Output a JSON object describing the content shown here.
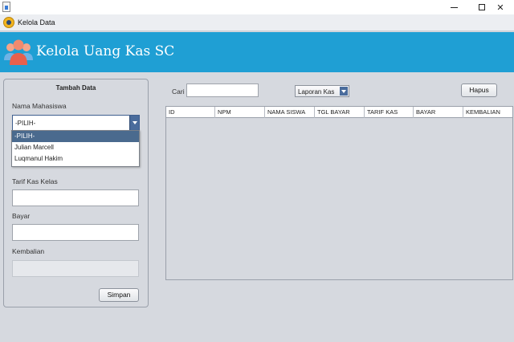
{
  "frame": {
    "title": "Kelola Data"
  },
  "banner": {
    "title": "Kelola Uang Kas SC",
    "color": "#1f9fd4"
  },
  "form": {
    "title": "Tambah Data",
    "nama_label": "Nama Mahasiswa",
    "nama_selected": "-PILIH-",
    "nama_options": [
      "-PILIH-",
      "Julian Marcell",
      "Luqmanul Hakim"
    ],
    "tarif_label": "Tarif Kas Kelas",
    "tarif_value": "",
    "bayar_label": "Bayar",
    "bayar_value": "",
    "kembalian_label": "Kembalian",
    "kembalian_value": "",
    "simpan_label": "Simpan"
  },
  "toolbar": {
    "cari_label": "Cari",
    "cari_value": "",
    "laporan_label": "Laporan Kas",
    "hapus_label": "Hapus"
  },
  "table": {
    "columns": [
      "ID",
      "NPM",
      "NAMA SISWA",
      "TGL BAYAR",
      "TARIF KAS",
      "BAYAR",
      "KEMBALIAN"
    ],
    "rows": []
  }
}
